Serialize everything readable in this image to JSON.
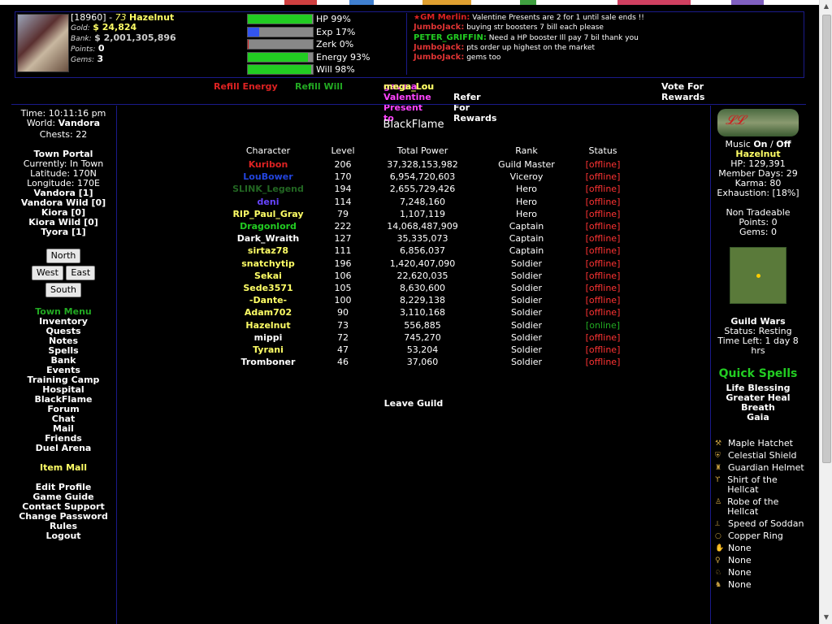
{
  "player": {
    "id": "[18960]",
    "level": "73",
    "name": "Hazelnut",
    "gold_label": "Gold:",
    "gold": "$ 24,824",
    "bank_label": "Bank:",
    "bank": "$ 2,001,305,896",
    "points_label": "Points:",
    "points": "0",
    "gems_label": "Gems:",
    "gems": "3"
  },
  "stats": [
    {
      "label": "HP 99%",
      "pct": 99,
      "color": "#22cc22"
    },
    {
      "label": "Exp 17%",
      "pct": 17,
      "color": "#3355ee"
    },
    {
      "label": "Zerk 0%",
      "pct": 0,
      "color": "#dd2222"
    },
    {
      "label": "Energy 93%",
      "pct": 93,
      "color": "#22cc22"
    },
    {
      "label": "Will 98%",
      "pct": 98,
      "color": "#22cc22"
    }
  ],
  "chat": [
    {
      "name": "GM Merlin",
      "msg": "Valentine Presents are 2 for 1 until sale ends !!"
    },
    {
      "name": "JumboJack",
      "msg": "buying str boosters 7 bill each please"
    },
    {
      "name": "PETER_GRIFFIN",
      "msg": "Need a HP booster Ill pay 7 bil thank you"
    },
    {
      "name": "JumboJack",
      "msg": "pts order up highest on the market"
    },
    {
      "name": "JumboJack",
      "msg": "gems too"
    }
  ],
  "topnav": {
    "refill_energy": "Refill Energy",
    "refill_will": "Refill Will",
    "event_user1": "mega_Lou",
    "event_text": "gave a Valentine Present to",
    "event_user2": "mega_Lou",
    "vote": "Vote For Rewards",
    "refer": "Refer For Rewards"
  },
  "left": {
    "time": "Time: 10:11:16 pm",
    "world_label": "World:",
    "world": "Vandora",
    "chests": "Chests: 22",
    "town_portal": "Town Portal",
    "currently": "Currently: In Town",
    "latitude": "Latitude: 170N",
    "longitude": "Longitude: 170E",
    "locations": [
      "Vandora [1]",
      "Vandora Wild [0]",
      "Kiora [0]",
      "Kiora Wild [0]",
      "Tyora [1]"
    ],
    "north": "North",
    "west": "West",
    "east": "East",
    "south": "South",
    "town_menu": "Town Menu",
    "menu": [
      "Inventory",
      "Quests",
      "Notes",
      "Spells",
      "Bank",
      "Events",
      "Training Camp",
      "Hospital",
      "BlackFlame",
      "Forum",
      "Chat",
      "Mail",
      "Friends",
      "Duel Arena"
    ],
    "item_mall": "Item Mall",
    "menu2": [
      "Edit Profile",
      "Game Guide",
      "Contact Support",
      "Change Password",
      "Rules",
      "Logout"
    ]
  },
  "guild": {
    "name": "BlackFlame",
    "headers": [
      "Character",
      "Level",
      "Total Power",
      "Rank",
      "Status"
    ],
    "members": [
      {
        "name": "Kuribon",
        "level": "206",
        "power": "37,328,153,982",
        "rank": "Guild Master",
        "status": "[offline]",
        "color": "#dd2222"
      },
      {
        "name": "LouBower",
        "level": "170",
        "power": "6,954,720,603",
        "rank": "Viceroy",
        "status": "[offline]",
        "color": "#2244dd"
      },
      {
        "name": "SLINK_Legend",
        "level": "194",
        "power": "2,655,729,426",
        "rank": "Hero",
        "status": "[offline]",
        "color": "#226622"
      },
      {
        "name": "deni",
        "level": "114",
        "power": "7,248,160",
        "rank": "Hero",
        "status": "[offline]",
        "color": "#6644ff"
      },
      {
        "name": "RIP_Paul_Gray",
        "level": "79",
        "power": "1,107,119",
        "rank": "Hero",
        "status": "[offline]",
        "color": "#ffff66"
      },
      {
        "name": "Dragonlord",
        "level": "222",
        "power": "14,068,487,909",
        "rank": "Captain",
        "status": "[offline]",
        "color": "#22cc22"
      },
      {
        "name": "Dark_Wraith",
        "level": "127",
        "power": "35,335,073",
        "rank": "Captain",
        "status": "[offline]",
        "color": "#ffffff"
      },
      {
        "name": "sirtaz78",
        "level": "111",
        "power": "6,856,037",
        "rank": "Captain",
        "status": "[offline]",
        "color": "#ffff66"
      },
      {
        "name": "snatchytip",
        "level": "196",
        "power": "1,420,407,090",
        "rank": "Soldier",
        "status": "[offline]",
        "color": "#ffff66"
      },
      {
        "name": "Sekai",
        "level": "106",
        "power": "22,620,035",
        "rank": "Soldier",
        "status": "[offline]",
        "color": "#ffff66"
      },
      {
        "name": "Sede3571",
        "level": "105",
        "power": "8,630,600",
        "rank": "Soldier",
        "status": "[offline]",
        "color": "#ffff66"
      },
      {
        "name": "-Dante-",
        "level": "100",
        "power": "8,229,138",
        "rank": "Soldier",
        "status": "[offline]",
        "color": "#ffff66"
      },
      {
        "name": "Adam702",
        "level": "90",
        "power": "3,110,168",
        "rank": "Soldier",
        "status": "[offline]",
        "color": "#ffff66"
      },
      {
        "name": "Hazelnut",
        "level": "73",
        "power": "556,885",
        "rank": "Soldier",
        "status": "[online]",
        "color": "#ffff66"
      },
      {
        "name": "mippi",
        "level": "72",
        "power": "745,270",
        "rank": "Soldier",
        "status": "[offline]",
        "color": "#ffffff"
      },
      {
        "name": "Tyrani",
        "level": "47",
        "power": "53,204",
        "rank": "Soldier",
        "status": "[offline]",
        "color": "#ffff66"
      },
      {
        "name": "Tromboner",
        "level": "46",
        "power": "37,060",
        "rank": "Soldier",
        "status": "[offline]",
        "color": "#ffffff"
      }
    ],
    "leave": "Leave Guild"
  },
  "right": {
    "music_label": "Music",
    "music_on": "On",
    "music_sep": "/",
    "music_off": "Off",
    "name": "Hazelnut",
    "hp": "HP: 129,391",
    "member_days": "Member Days: 29",
    "karma": "Karma: 80",
    "exhaustion": "Exhaustion: [18%]",
    "non_tradeable": "Non Tradeable",
    "points": "Points: 0",
    "gems": "Gems: 0",
    "guild_wars": "Guild Wars",
    "gw_status": "Status: Resting",
    "gw_time": "Time Left: 1 day 8 hrs",
    "quick_spells": "Quick Spells",
    "spells": [
      "Life Blessing",
      "Greater Heal",
      "Breath",
      "Gaia"
    ],
    "equipment": [
      "Maple Hatchet",
      "Celestial Shield",
      "Guardian Helmet",
      "Shirt of the Hellcat",
      "Robe of the Hellcat",
      "Speed of Soddan",
      "Copper Ring",
      "None",
      "None",
      "None",
      "None"
    ]
  }
}
